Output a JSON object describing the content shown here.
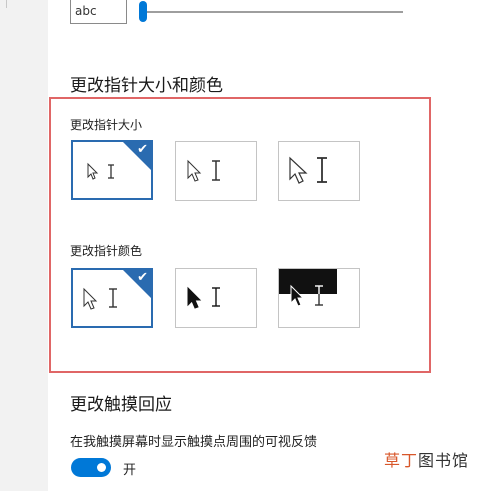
{
  "text_preview": {
    "sample": "abc"
  },
  "text_size_slider": {
    "level": 0.02
  },
  "section_pointer": {
    "heading": "更改指针大小和颜色",
    "size_label": "更改指针大小",
    "size_options": [
      {
        "id": "small",
        "selected": true
      },
      {
        "id": "medium",
        "selected": false
      },
      {
        "id": "large",
        "selected": false
      }
    ],
    "color_label": "更改指针颜色",
    "color_options": [
      {
        "id": "white",
        "selected": true
      },
      {
        "id": "black",
        "selected": false
      },
      {
        "id": "inverted",
        "selected": false
      }
    ],
    "check_glyph": "✔"
  },
  "section_touch": {
    "heading": "更改触摸回应",
    "description": "在我触摸屏幕时显示触摸点周围的可视反馈",
    "toggle_state": "开",
    "toggle_on": true
  },
  "watermark": {
    "accent": "草丁",
    "rest": "图书馆"
  },
  "colors": {
    "accent": "#0078d7",
    "selection": "#2a6bb0",
    "highlight": "#e06666"
  },
  "icons": [
    "arrow-pointer-icon",
    "text-cursor-icon",
    "checkmark-icon"
  ]
}
